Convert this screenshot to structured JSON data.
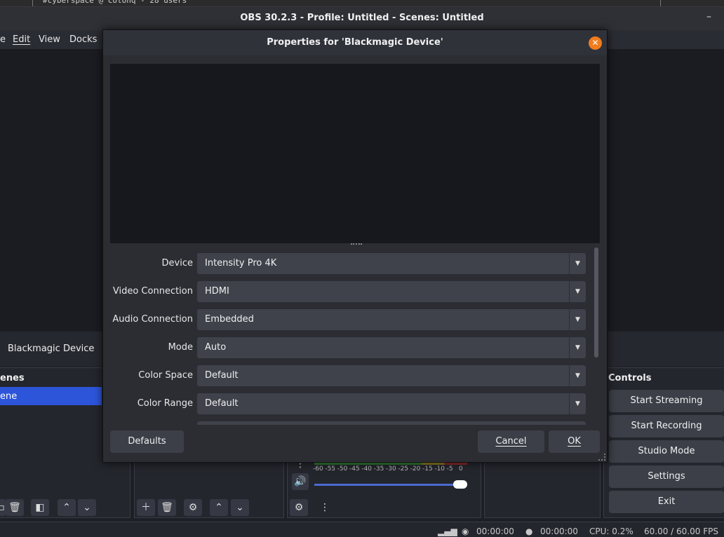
{
  "background_terminal": {
    "text": "#cyberspace @ colonq - 28 users"
  },
  "window": {
    "title": "OBS 30.2.3 - Profile: Untitled - Scenes: Untitled",
    "minimize_glyph": "–"
  },
  "menu": {
    "items": [
      "e",
      "Edit",
      "View",
      "Docks"
    ]
  },
  "source_bar": {
    "selected_source": "Blackmagic Device"
  },
  "scenes_dock": {
    "title": "enes",
    "items": [
      "ene"
    ]
  },
  "controls_dock": {
    "title": "Controls",
    "buttons": [
      "Start Streaming",
      "Start Recording",
      "Studio Mode",
      "Settings",
      "Exit"
    ]
  },
  "audio_mixer": {
    "meter_ticks": [
      "-60",
      "-55",
      "-50",
      "-45",
      "-40",
      "-35",
      "-30",
      "-25",
      "-20",
      "-15",
      "-10",
      "-5",
      "0"
    ],
    "volume_level": 1.0
  },
  "status_bar": {
    "stream_time": "00:00:00",
    "record_time": "00:00:00",
    "cpu": "CPU: 0.2%",
    "fps": "60.00 / 60.00 FPS"
  },
  "dialog": {
    "title": "Properties for 'Blackmagic Device'",
    "properties": [
      {
        "label": "Device",
        "value": "Intensity Pro 4K"
      },
      {
        "label": "Video Connection",
        "value": "HDMI"
      },
      {
        "label": "Audio Connection",
        "value": "Embedded"
      },
      {
        "label": "Mode",
        "value": "Auto"
      },
      {
        "label": "Color Space",
        "value": "Default"
      },
      {
        "label": "Color Range",
        "value": "Default"
      }
    ],
    "defaults_label": "Defaults",
    "cancel_label": "Cancel",
    "ok_label": "OK"
  },
  "colors": {
    "accent": "#2d55d9",
    "close": "#f07c1e",
    "panel": "#2b2d33"
  }
}
